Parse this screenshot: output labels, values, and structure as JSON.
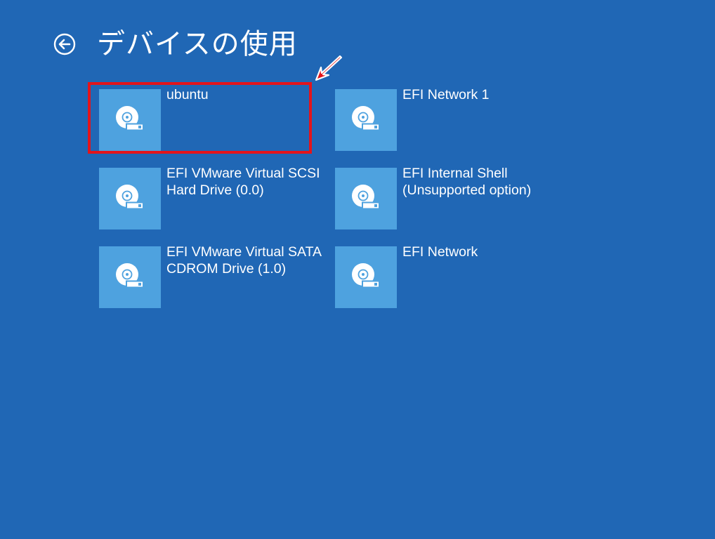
{
  "page": {
    "title": "デバイスの使用",
    "back_icon": "back-arrow-circle-icon"
  },
  "devices": [
    {
      "label": "ubuntu",
      "icon": "disk-drive-icon"
    },
    {
      "label": "EFI Network 1",
      "icon": "disk-drive-icon"
    },
    {
      "label": "EFI VMware Virtual SCSI Hard Drive (0.0)",
      "icon": "disk-drive-icon"
    },
    {
      "label": "EFI Internal Shell (Unsupported option)",
      "icon": "disk-drive-icon"
    },
    {
      "label": "EFI VMware Virtual SATA CDROM Drive (1.0)",
      "icon": "disk-drive-icon"
    },
    {
      "label": "EFI Network",
      "icon": "disk-drive-icon"
    }
  ],
  "annotation": {
    "highlight_color": "#e3141b",
    "arrow_icon": "red-arrow-icon"
  },
  "colors": {
    "background": "#2067b5",
    "tile": "#4ea2df",
    "text": "#ffffff"
  }
}
